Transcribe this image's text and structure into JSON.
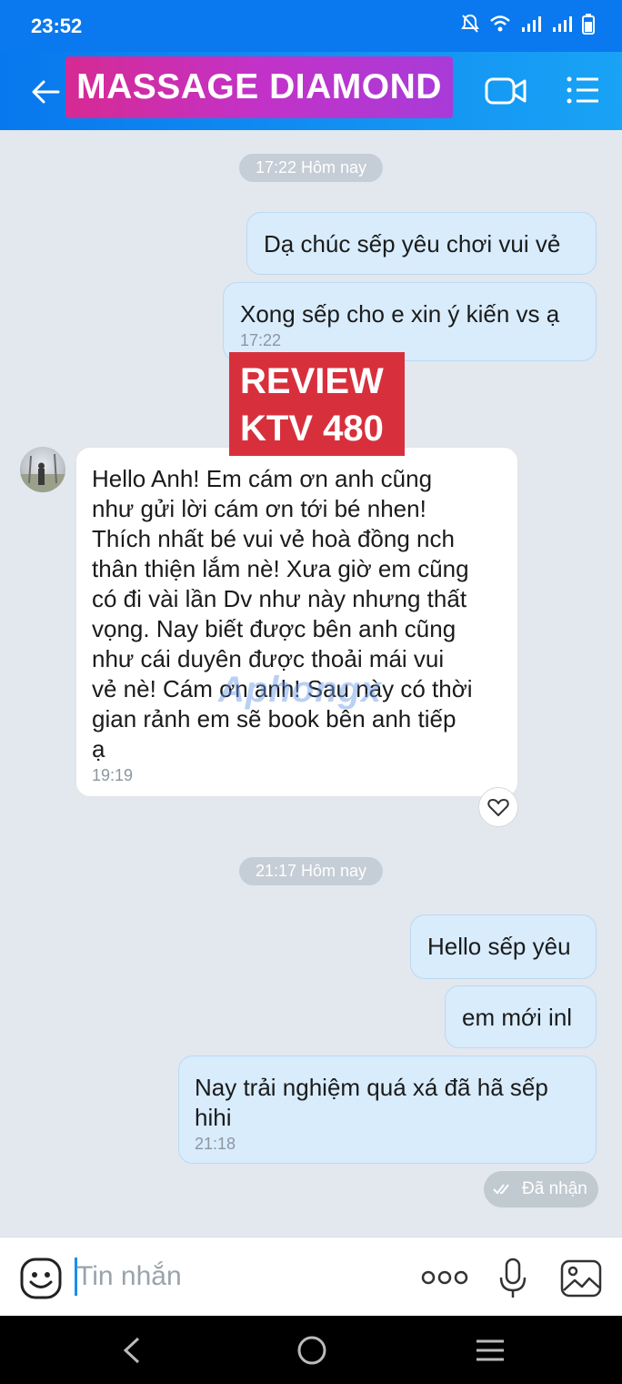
{
  "status_bar": {
    "time": "23:52"
  },
  "header": {
    "title": "MASSAGE DIAMOND"
  },
  "chat": {
    "divider_1": "17:22 Hôm nay",
    "msg_1": "Dạ chúc sếp yêu chơi vui vẻ",
    "msg_2": "Xong sếp cho e xin ý kiến vs ạ",
    "msg_2_time": "17:22",
    "review_badge": {
      "line1": "REVIEW",
      "line2": "KTV 480"
    },
    "msg_3_lines": [
      "Hello Anh! Em cám ơn anh cũng",
      "như gửi lời cám ơn tới bé nhen!",
      "Thích nhất bé vui vẻ hoà đồng nch",
      "thân thiện lắm nè! Xưa giờ em cũng",
      "có đi vài lần Dv như này nhưng thất",
      "vọng. Nay biết được bên anh cũng",
      "như cái duyên được thoải mái vui",
      "vẻ nè! Cám ơn anh! Sau này có thời",
      "gian rảnh em sẽ book bên anh tiếp",
      "ạ"
    ],
    "msg_3_time": "19:19",
    "watermark": "Aphongx",
    "divider_2": "21:17 Hôm nay",
    "msg_4": "Hello sếp yêu",
    "msg_5": "em mới inl",
    "msg_6_line1": "Nay trải nghiệm quá xá đã hã sếp",
    "msg_6_line2": "hihi",
    "msg_6_time": "21:18",
    "status": "Đã nhận"
  },
  "input": {
    "placeholder": "Tin nhắn"
  },
  "icons": [
    "back-arrow-icon",
    "video-call-icon",
    "menu-list-icon",
    "heart-icon",
    "emoji-icon",
    "more-icon",
    "microphone-icon",
    "image-icon"
  ],
  "colors": {
    "header": "#0a78ee",
    "title_bg": "#c232c8",
    "out_bubble": "#d8ecfc",
    "badge": "#d7303c"
  }
}
